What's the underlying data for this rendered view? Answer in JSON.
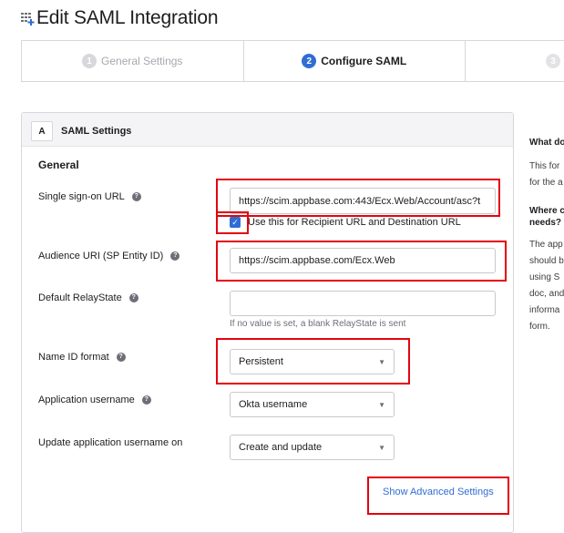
{
  "page": {
    "title": "Edit SAML Integration"
  },
  "wizard": {
    "steps": [
      {
        "number": "1",
        "label": "General Settings"
      },
      {
        "number": "2",
        "label": "Configure SAML"
      },
      {
        "number": "3",
        "label": ""
      }
    ]
  },
  "section": {
    "letter": "A",
    "title": "SAML Settings",
    "subheading": "General"
  },
  "form": {
    "sso_url": {
      "label": "Single sign-on URL",
      "value": "https://scim.appbase.com:443/Ecx.Web/Account/asc?t",
      "checkbox_label": "Use this for Recipient URL and Destination URL",
      "checkbox_checked": true
    },
    "audience_uri": {
      "label": "Audience URI (SP Entity ID)",
      "value": "https://scim.appbase.com/Ecx.Web"
    },
    "relay_state": {
      "label": "Default RelayState",
      "value": "",
      "hint": "If no value is set, a blank RelayState is sent"
    },
    "name_id_format": {
      "label": "Name ID format",
      "value": "Persistent"
    },
    "app_username": {
      "label": "Application username",
      "value": "Okta username"
    },
    "update_username_on": {
      "label": "Update application username on",
      "value": "Create and update"
    },
    "advanced_link": "Show Advanced Settings"
  },
  "sidebar": {
    "heading1": "What do",
    "p1": [
      "This for",
      "for the a"
    ],
    "heading2": [
      "Where c",
      "needs?"
    ],
    "p2": [
      "The app",
      "should b",
      "using S",
      "doc, and",
      "informa",
      "form."
    ]
  },
  "colors": {
    "accent": "#2f6dd5",
    "highlight": "#e3040e"
  }
}
